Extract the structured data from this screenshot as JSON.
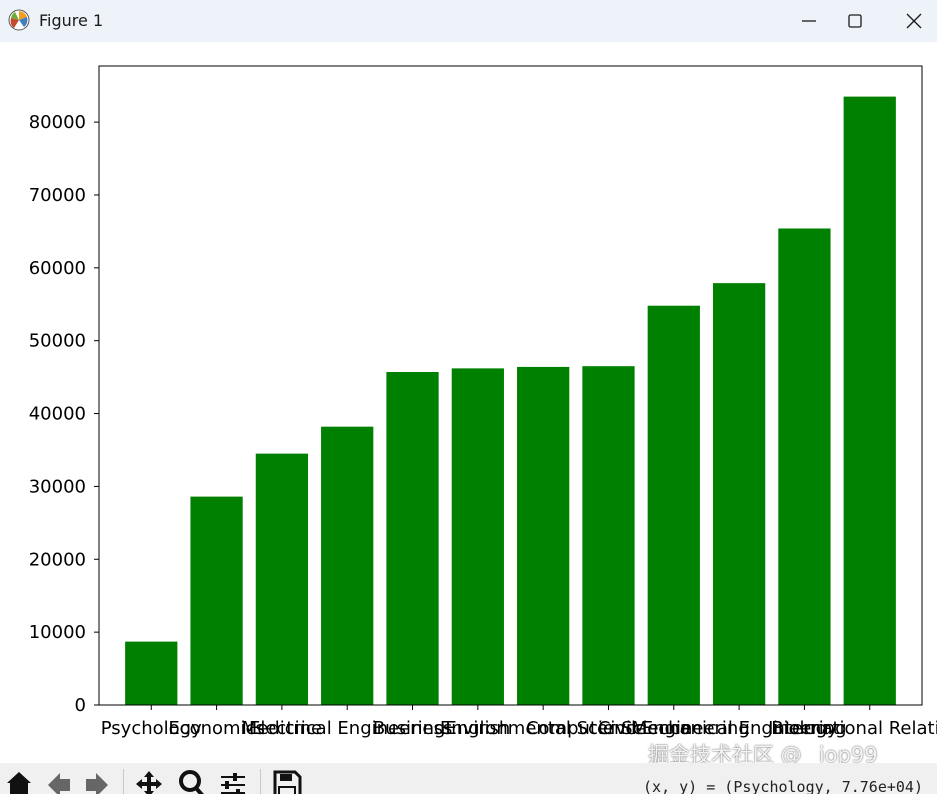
{
  "window": {
    "title": "Figure 1",
    "icon": "matplotlib-icon",
    "controls": [
      "minimize-icon",
      "maximize-icon",
      "close-icon"
    ]
  },
  "toolbar": {
    "buttons": [
      "home-icon",
      "back-icon",
      "forward-icon",
      "pan-icon",
      "zoom-icon",
      "configure-subplots-icon",
      "save-icon"
    ],
    "coords": "(x, y) = (Psychology, 7.76e+04)"
  },
  "watermark": "掘金技术社区 @ _iop99",
  "chart_data": {
    "type": "bar",
    "title": "",
    "xlabel": "",
    "ylabel": "",
    "categories": [
      "Psychology",
      "Economics",
      "Medicine",
      "Electrical Engineering",
      "Business",
      "English",
      "Environmental Science",
      "Computer Science",
      "Civil Engineering",
      "Mechanical Engineering",
      "Biology",
      "International Relations"
    ],
    "values": [
      8700,
      28600,
      34500,
      38200,
      45700,
      46200,
      46400,
      46500,
      54800,
      57900,
      65400,
      83500
    ],
    "ylim": [
      0,
      87700
    ],
    "yticks": [
      0,
      10000,
      20000,
      30000,
      40000,
      50000,
      60000,
      70000,
      80000
    ],
    "bar_color": "#008000",
    "grid": false
  }
}
